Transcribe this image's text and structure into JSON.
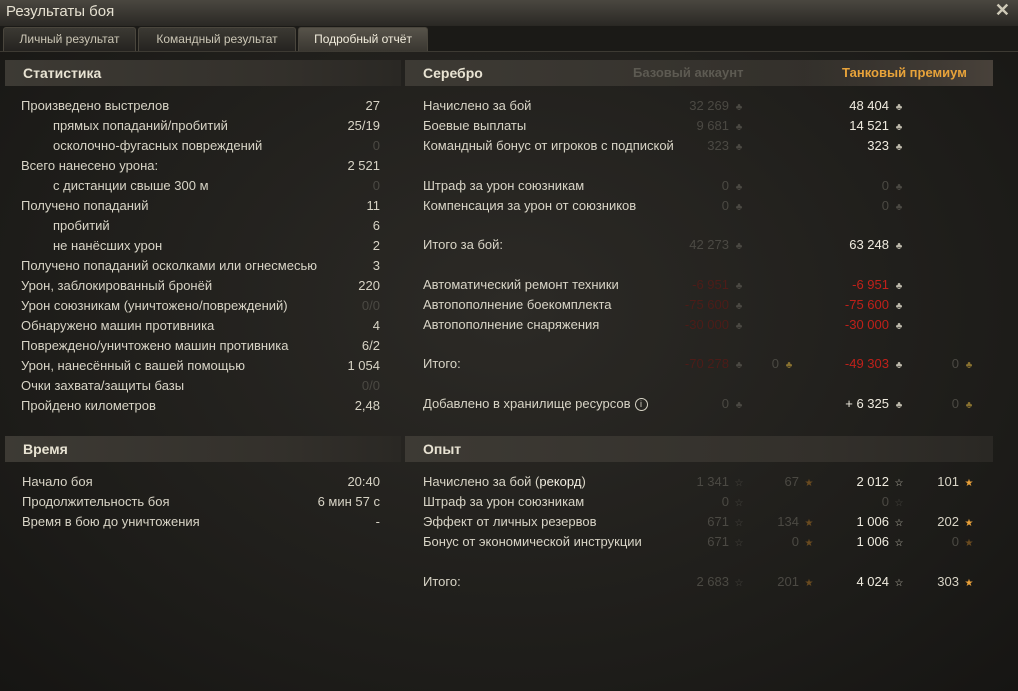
{
  "window": {
    "title": "Результаты боя",
    "close": "✕"
  },
  "tabs": [
    "Личный результат",
    "Командный результат",
    "Подробный отчёт"
  ],
  "stats": {
    "title": "Статистика",
    "rows": [
      {
        "label": "Произведено выстрелов",
        "value": "27"
      },
      {
        "label": "прямых попаданий/пробитий",
        "value": "25/19"
      },
      {
        "label": "осколочно-фугасных повреждений",
        "value": "0"
      },
      {
        "label": "Всего нанесено урона:",
        "value": "2 521"
      },
      {
        "label": "с дистанции свыше 300 м",
        "value": "0"
      },
      {
        "label": "Получено попаданий",
        "value": "11"
      },
      {
        "label": "пробитий",
        "value": "6"
      },
      {
        "label": "не нанёсших урон",
        "value": "2"
      },
      {
        "label": "Получено попаданий осколками или огнесмесью",
        "value": "3"
      },
      {
        "label": "Урон, заблокированный бронёй",
        "value": "220"
      },
      {
        "label": "Урон союзникам (уничтожено/повреждений)",
        "value": "0/0"
      },
      {
        "label": "Обнаружено машин противника",
        "value": "4"
      },
      {
        "label": "Повреждено/уничтожено машин противника",
        "value": "6/2"
      },
      {
        "label": "Урон, нанесённый с вашей помощью",
        "value": "1 054"
      },
      {
        "label": "Очки захвата/защиты базы",
        "value": "0/0"
      },
      {
        "label": "Пройдено километров",
        "value": "2,48"
      }
    ]
  },
  "time": {
    "title": "Время",
    "rows": [
      {
        "label": "Начало боя",
        "value": "20:40"
      },
      {
        "label": "Продолжительность боя",
        "value": "6 мин 57 с"
      },
      {
        "label": "Время в бою до уничтожения",
        "value": "-"
      }
    ]
  },
  "silver": {
    "title": "Серебро",
    "col_base": "Базовый аккаунт",
    "col_prem": "Танковый премиум",
    "rows": [
      {
        "label": "Начислено за бой",
        "base": "32 269",
        "prem": "48 404"
      },
      {
        "label": "Боевые выплаты",
        "base": "9 681",
        "prem": "14 521"
      },
      {
        "label": "Командный бонус от игроков с подпиской",
        "base": "323",
        "prem": "323"
      },
      {
        "label": "Штраф за урон союзникам",
        "base": "0",
        "prem": "0"
      },
      {
        "label": "Компенсация за урон от союзников",
        "base": "0",
        "prem": "0"
      },
      {
        "label": "Итого за бой:",
        "base": "42 273",
        "prem": "63 248"
      },
      {
        "label": "Автоматический ремонт техники",
        "base": "-6 951",
        "prem": "-6 951"
      },
      {
        "label": "Автопополнение боекомплекта",
        "base": "-75 600",
        "prem": "-75 600"
      },
      {
        "label": "Автопополнение снаряжения",
        "base": "-30 000",
        "prem": "-30 000"
      },
      {
        "label": "Итого:",
        "base": "-70 278",
        "base_gold": "0",
        "prem": "-49 303",
        "prem_gold": "0"
      },
      {
        "label": "Добавлено в хранилище ресурсов",
        "info": "i",
        "base": "0",
        "base_gold": "0",
        "prem": "+ 6 325",
        "prem_gold": "0"
      }
    ]
  },
  "xp": {
    "title": "Опыт",
    "label_prefix": "Начислено за бой (",
    "label_record": "рекорд",
    "label_suffix": ")",
    "rows": [
      {
        "base": "1 341",
        "base_free": "67",
        "prem": "2 012",
        "prem_free": "101"
      },
      {
        "label": "Штраф за урон союзникам",
        "base": "0",
        "prem": "0"
      },
      {
        "label": "Эффект от личных резервов",
        "base": "671",
        "base_free": "134",
        "prem": "1 006",
        "prem_free": "202"
      },
      {
        "label": "Бонус от экономической инструкции",
        "base": "671",
        "base_free": "0",
        "prem": "1 006",
        "prem_free": "0"
      },
      {
        "label": "Итого:",
        "base": "2 683",
        "base_free": "201",
        "prem": "4 024",
        "prem_free": "303"
      }
    ]
  },
  "icons": {
    "coin": "credits-icon",
    "gold": "gold-icon",
    "star": "xp-icon",
    "freexp": "free-xp-icon"
  }
}
